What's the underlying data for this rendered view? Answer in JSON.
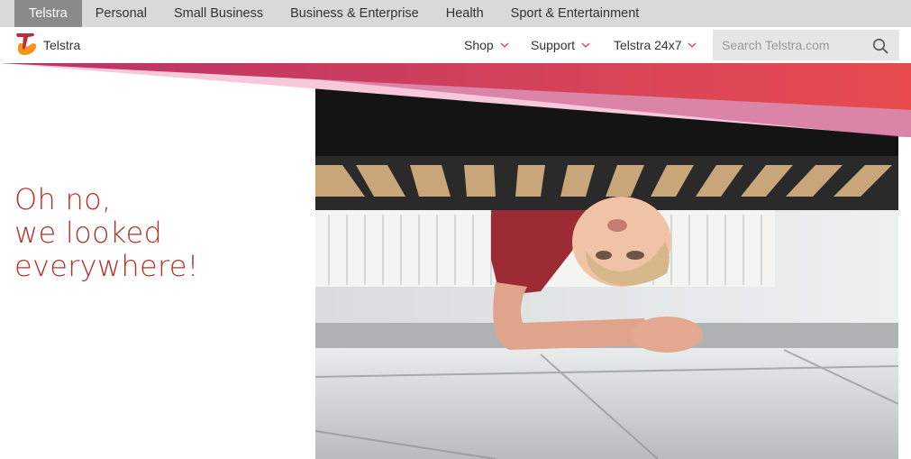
{
  "topnav": {
    "tabs": [
      {
        "label": "Telstra",
        "active": true
      },
      {
        "label": "Personal"
      },
      {
        "label": "Small Business"
      },
      {
        "label": "Business & Enterprise"
      },
      {
        "label": "Health"
      },
      {
        "label": "Sport & Entertainment"
      }
    ]
  },
  "header": {
    "brand": "Telstra",
    "nav": [
      {
        "label": "Shop"
      },
      {
        "label": "Support"
      },
      {
        "label": "Telstra 24x7"
      }
    ],
    "search_placeholder": "Search Telstra.com"
  },
  "hero": {
    "headline": [
      "Oh no,",
      "we looked",
      "everywhere!"
    ],
    "headline_color": "#b5322a",
    "accent_gradient": [
      "#b8336a",
      "#e84c4f"
    ]
  }
}
